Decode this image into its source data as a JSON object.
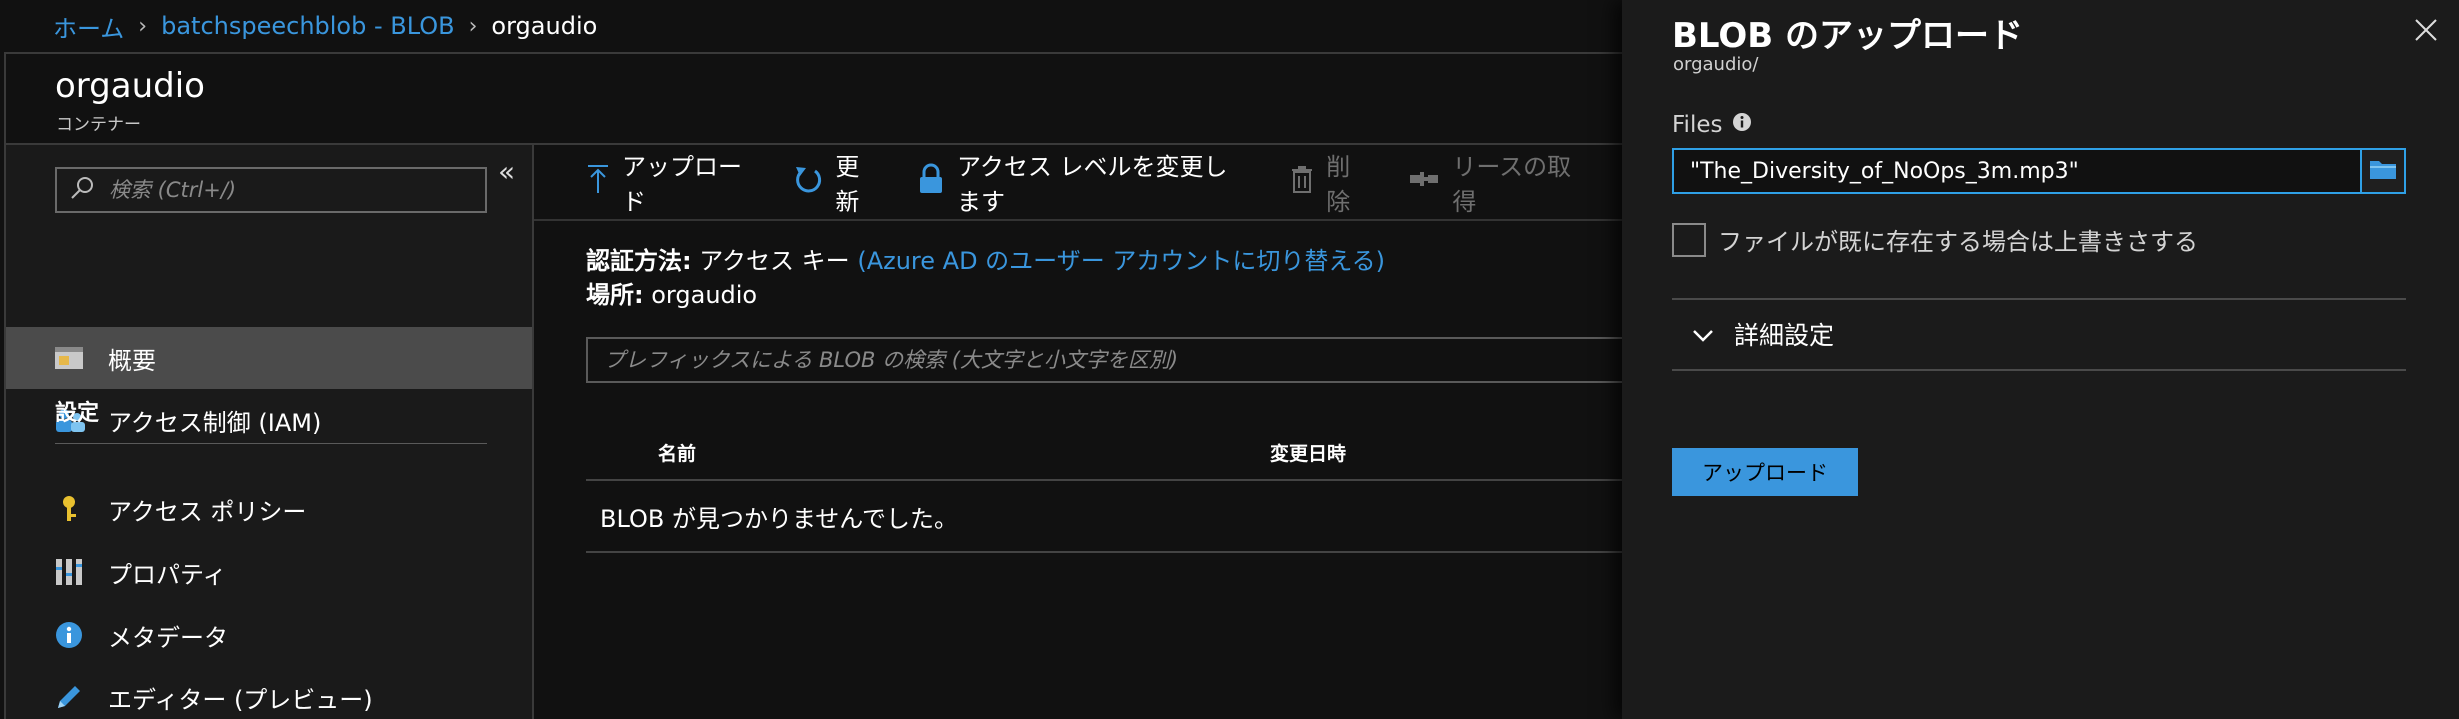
{
  "breadcrumb": {
    "home": "ホーム",
    "account": "batchspeechblob - BLOB",
    "current": "orgaudio"
  },
  "container": {
    "title": "orgaudio",
    "subtitle": "コンテナー"
  },
  "nav": {
    "search_placeholder": "検索 (Ctrl+/)",
    "collapse_glyph": "«",
    "items": [
      {
        "label": "概要",
        "icon": "overview-icon",
        "active": true
      },
      {
        "label": "アクセス制御 (IAM)",
        "icon": "access-control-icon",
        "active": false
      }
    ],
    "section_settings": "設定",
    "settings_items": [
      {
        "label": "アクセス ポリシー",
        "icon": "key-icon"
      },
      {
        "label": "プロパティ",
        "icon": "properties-icon"
      },
      {
        "label": "メタデータ",
        "icon": "info-icon"
      },
      {
        "label": "エディター (プレビュー)",
        "icon": "pencil-icon"
      }
    ]
  },
  "toolbar": {
    "upload": "アップロード",
    "refresh": "更新",
    "change_access": "アクセス レベルを変更します",
    "delete": "削除",
    "lease": "リースの取得"
  },
  "main": {
    "auth_label": "認証方法:",
    "auth_value": "アクセス キー",
    "auth_link": "(Azure AD のユーザー アカウントに切り替える)",
    "location_label": "場所:",
    "location_value": "orgaudio",
    "blob_search_placeholder": "プレフィックスによる BLOB の検索 (大文字と小文字を区別)",
    "columns": {
      "name": "名前",
      "modified": "変更日時"
    },
    "empty_message": "BLOB が見つかりませんでした。"
  },
  "upload_panel": {
    "title": "BLOB のアップロード",
    "path": "orgaudio/",
    "files_label": "Files",
    "file_value": "\"The_Diversity_of_NoOps_3m.mp3\"",
    "overwrite_label": "ファイルが既に存在する場合は上書きさする",
    "advanced_label": "詳細設定",
    "submit_label": "アップロード"
  },
  "colors": {
    "accent": "#3a96dd",
    "background": "#111111",
    "panel": "#1b1b1b",
    "active_nav": "#4b4b4b",
    "input_focus": "#2fa0e6"
  }
}
